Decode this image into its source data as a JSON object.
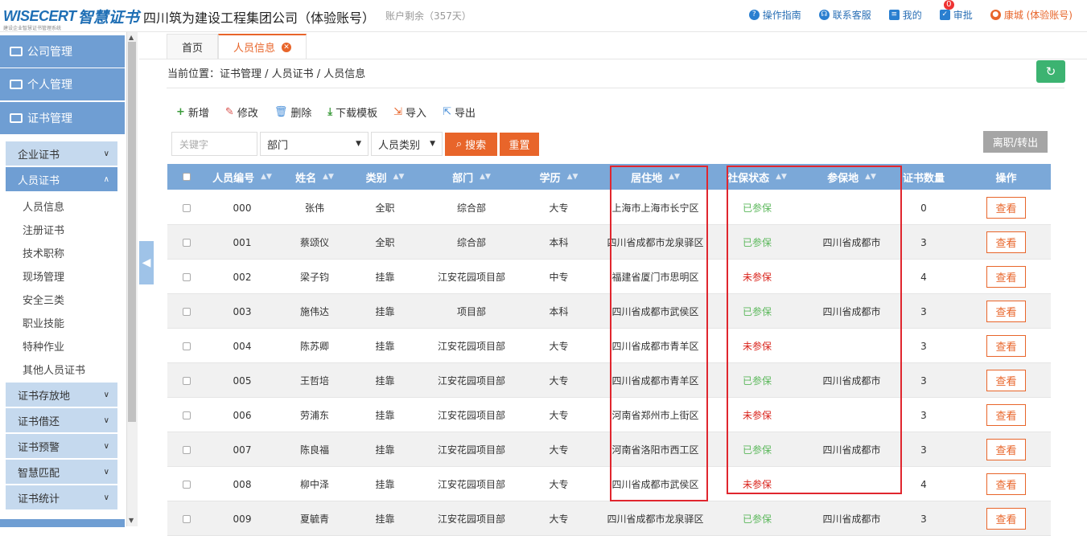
{
  "logo": {
    "en": "WISECERT",
    "cn": "智慧证书",
    "sub": "建设企业智慧证书管理系统"
  },
  "header": {
    "company": "四川筑为建设工程集团公司（体验账号）",
    "remain": "账户剩余（357天）",
    "nav": {
      "guide": "操作指南",
      "support": "联系客服",
      "mine": "我的",
      "approve": "审批",
      "approve_badge": "0",
      "user": "康城 (体验账号)"
    }
  },
  "sidebar": {
    "modules": [
      "公司管理",
      "个人管理",
      "证书管理"
    ],
    "groups": {
      "enterprise": "企业证书",
      "personnel": "人员证书"
    },
    "leaves": [
      "人员信息",
      "注册证书",
      "技术职称",
      "现场管理",
      "安全三类",
      "职业技能",
      "特种作业",
      "其他人员证书"
    ],
    "bottom": [
      "证书存放地",
      "证书借还",
      "证书预警",
      "智慧匹配",
      "证书统计"
    ]
  },
  "tabs": [
    "首页",
    "人员信息"
  ],
  "breadcrumb": "当前位置：证书管理 / 人员证书 / 人员信息",
  "toolbar": {
    "add": "新增",
    "edit": "修改",
    "del": "删除",
    "tpl": "下载模板",
    "imp": "导入",
    "exp": "导出"
  },
  "filters": {
    "keyword_ph": "关键字",
    "dept": "部门",
    "type": "人员类别",
    "search": "搜索",
    "reset": "重置",
    "leave": "离职/转出"
  },
  "table": {
    "headers": [
      "人员编号",
      "姓名",
      "类别",
      "部门",
      "学历",
      "居住地",
      "社保状态",
      "参保地",
      "证书数量",
      "操作"
    ],
    "rows": [
      [
        "000",
        "张伟",
        "全职",
        "综合部",
        "大专",
        "上海市上海市长宁区",
        "已参保",
        "",
        "0",
        "查看"
      ],
      [
        "001",
        "蔡颂仪",
        "全职",
        "综合部",
        "本科",
        "四川省成都市龙泉驿区",
        "已参保",
        "四川省成都市",
        "3",
        "查看"
      ],
      [
        "002",
        "梁子钧",
        "挂靠",
        "江安花园项目部",
        "中专",
        "福建省厦门市思明区",
        "未参保",
        "",
        "4",
        "查看"
      ],
      [
        "003",
        "施伟达",
        "挂靠",
        "项目部",
        "本科",
        "四川省成都市武侯区",
        "已参保",
        "四川省成都市",
        "3",
        "查看"
      ],
      [
        "004",
        "陈苏卿",
        "挂靠",
        "江安花园项目部",
        "大专",
        "四川省成都市青羊区",
        "未参保",
        "",
        "3",
        "查看"
      ],
      [
        "005",
        "王哲培",
        "挂靠",
        "江安花园项目部",
        "大专",
        "四川省成都市青羊区",
        "已参保",
        "四川省成都市",
        "3",
        "查看"
      ],
      [
        "006",
        "劳浦东",
        "挂靠",
        "江安花园项目部",
        "大专",
        "河南省郑州市上街区",
        "未参保",
        "",
        "3",
        "查看"
      ],
      [
        "007",
        "陈良福",
        "挂靠",
        "江安花园项目部",
        "大专",
        "河南省洛阳市西工区",
        "已参保",
        "四川省成都市",
        "3",
        "查看"
      ],
      [
        "008",
        "柳中泽",
        "挂靠",
        "江安花园项目部",
        "大专",
        "四川省成都市武侯区",
        "未参保",
        "",
        "4",
        "查看"
      ],
      [
        "009",
        "夏毓青",
        "挂靠",
        "江安花园项目部",
        "大专",
        "四川省成都市龙泉驿区",
        "已参保",
        "四川省成都市",
        "3",
        "查看"
      ]
    ]
  }
}
